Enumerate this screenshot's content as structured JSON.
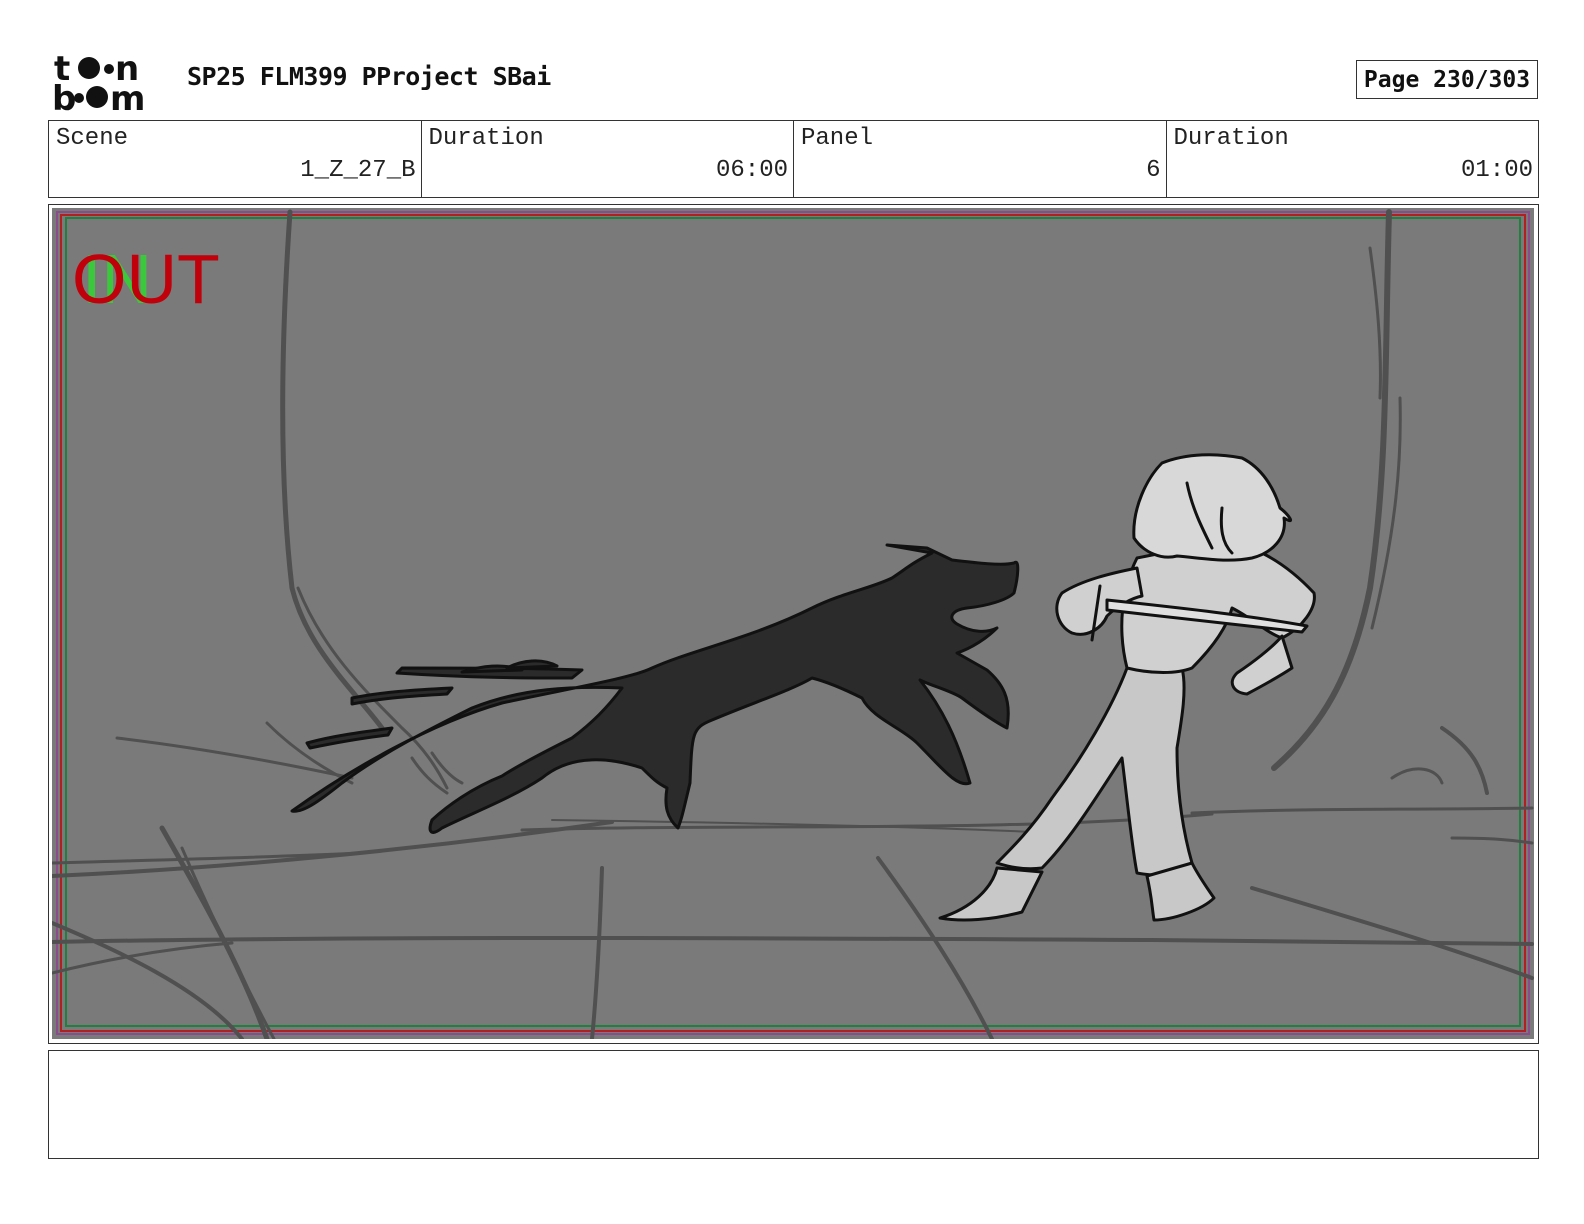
{
  "header": {
    "logo_text": "toon boom",
    "project_title": "SP25 FLM399 PProject SBai",
    "page_label": "Page 230/303"
  },
  "info": {
    "scene_label": "Scene",
    "scene_value": "1_Z_27_B",
    "scene_duration_label": "Duration",
    "scene_duration_value": "06:00",
    "panel_label": "Panel",
    "panel_value": "6",
    "panel_duration_label": "Duration",
    "panel_duration_value": "01:00"
  },
  "panel": {
    "overlay_out": "OUT",
    "overlay_in": "IN",
    "out_color": "#c0000a",
    "in_color": "#3cc83c",
    "background_color": "#7a7a7a",
    "subjects": [
      "shadow-wolf-creature",
      "sword-wielding-character"
    ]
  },
  "notes": {
    "text": ""
  }
}
